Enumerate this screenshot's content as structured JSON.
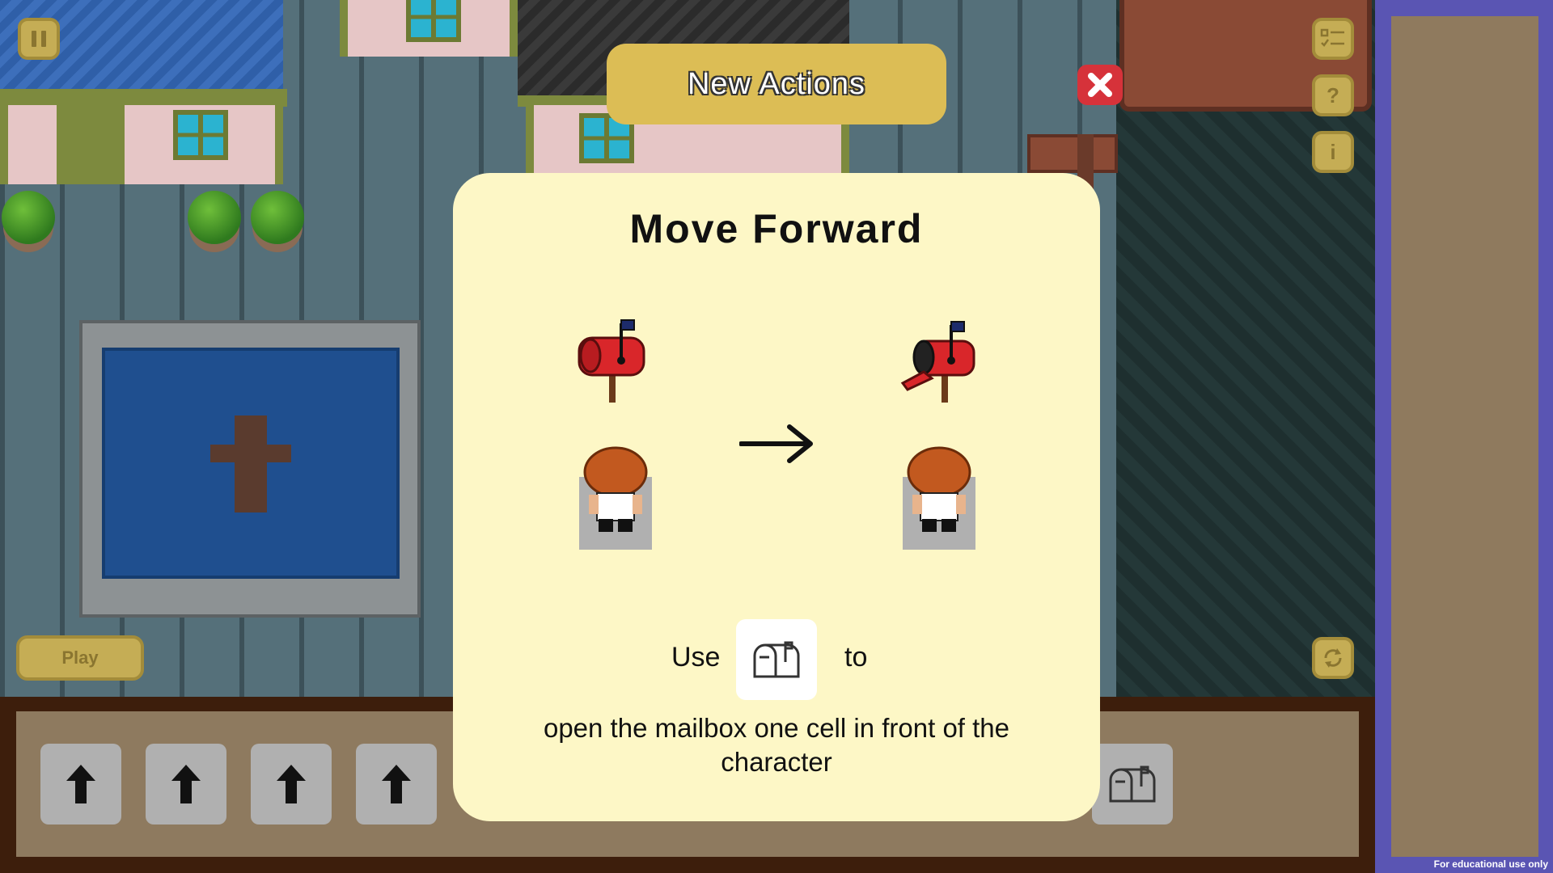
{
  "header": {
    "title": "New Actions"
  },
  "modal": {
    "title": "Move Forward",
    "use_label": "Use",
    "to_label": "to",
    "description": "open the mailbox one cell in front of the character",
    "action_icon": "mailbox-icon"
  },
  "hud": {
    "play_label": "Play",
    "pause_icon": "pause-icon",
    "checklist_icon": "checklist-icon",
    "help_label": "?",
    "info_label": "i",
    "reset_icon": "reset-icon",
    "close_icon": "close-icon"
  },
  "action_bar": {
    "slots": [
      {
        "icon": "up-arrow-icon"
      },
      {
        "icon": "up-arrow-icon"
      },
      {
        "icon": "up-arrow-icon"
      },
      {
        "icon": "up-arrow-icon"
      },
      {
        "icon": "mailbox-icon"
      }
    ]
  },
  "footer": {
    "notice": "For educational use only"
  },
  "colors": {
    "header_pill": "#dcbd55",
    "modal_bg": "#fdf7c6",
    "close_red": "#d6323a",
    "sidebar_purple": "#5a55b3",
    "hud_gold": "#c5ad55"
  }
}
